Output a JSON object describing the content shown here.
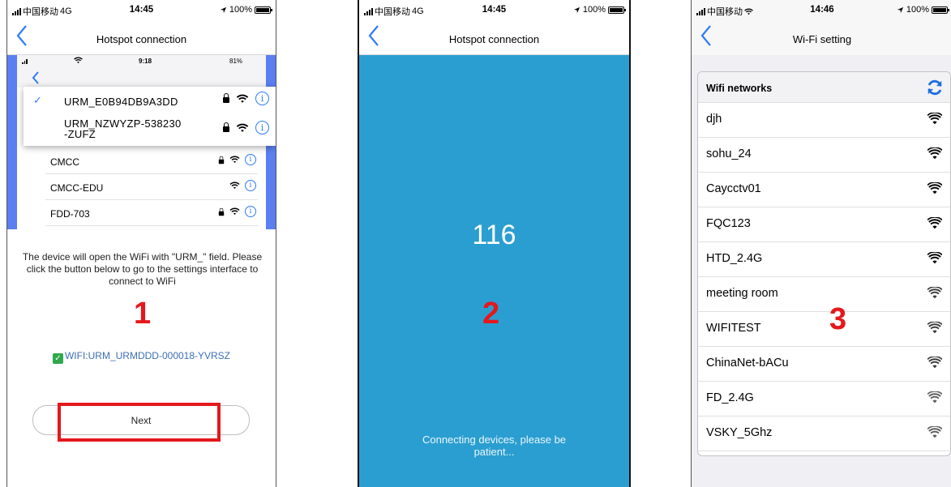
{
  "status1": {
    "carrier": "中国移动",
    "network": "4G",
    "time": "14:45",
    "battery": "100%"
  },
  "status2": {
    "carrier": "中国移动",
    "network": "4G",
    "time": "14:45",
    "battery": "100%"
  },
  "status3": {
    "carrier": "中国移动",
    "time": "14:46",
    "battery": "100%"
  },
  "screen1": {
    "title": "Hotspot connection",
    "inner_status": {
      "time": "9:18",
      "battery": "81%"
    },
    "popup_networks": [
      "URM_E0B94DB9A3DD",
      "URM_NZWYZP-538230\n-ZUFZ"
    ],
    "networks": [
      "CMCC",
      "CMCC-EDU",
      "FDD-703"
    ],
    "description": "The device will open the WiFi with \"URM_\" field. Please click the button below to go to the settings interface to connect to WiFi",
    "marker": "1",
    "wifi": "WIFI:URM_URMDDD-000018-YVRSZ",
    "next_label": "Next"
  },
  "screen2": {
    "title": "Hotspot connection",
    "countdown": "116",
    "marker": "2",
    "message": "Connecting devices, please be patient..."
  },
  "screen3": {
    "title": "Wi-Fi setting",
    "header": "Wifi networks",
    "marker": "3",
    "networks": [
      {
        "name": "djh",
        "strength": 1.0
      },
      {
        "name": "sohu_24",
        "strength": 1.0
      },
      {
        "name": "Caycctv01",
        "strength": 1.0
      },
      {
        "name": "FQC123",
        "strength": 1.0
      },
      {
        "name": "HTD_2.4G",
        "strength": 1.0
      },
      {
        "name": "meeting room",
        "strength": 0.75
      },
      {
        "name": "WIFITEST",
        "strength": 0.75
      },
      {
        "name": "ChinaNet-bACu",
        "strength": 0.75
      },
      {
        "name": "FD_2.4G",
        "strength": 0.6
      },
      {
        "name": "VSKY_5Ghz",
        "strength": 0.6
      }
    ]
  },
  "colors": {
    "accent": "#2f7cf6",
    "marker": "#e4181c",
    "progress_bg": "#2b9ed1",
    "check": "#2ea84a"
  },
  "icons": [
    "signal-icon",
    "battery-icon",
    "location-icon",
    "back-chevron-icon",
    "checkmark-icon",
    "lock-icon",
    "wifi-icon",
    "info-icon",
    "refresh-icon"
  ]
}
